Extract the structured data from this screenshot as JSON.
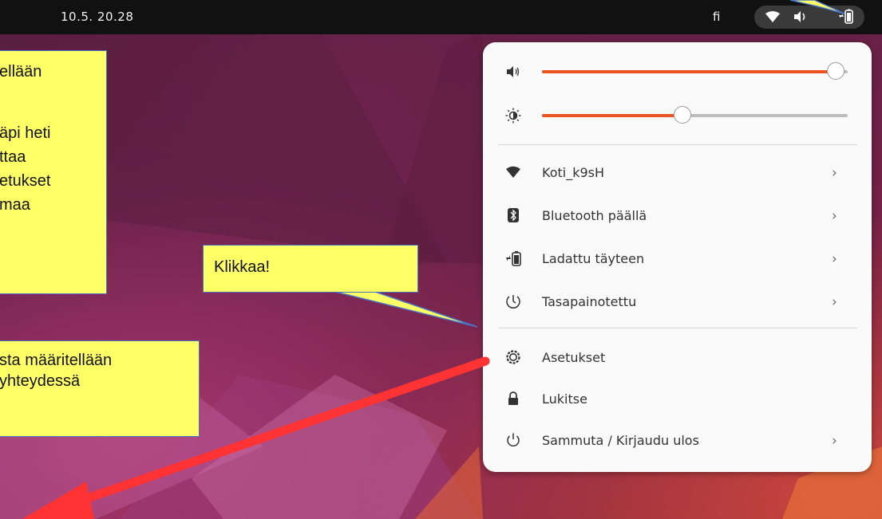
{
  "topbar": {
    "clock": "10.5.  20.28",
    "language": "fi"
  },
  "callouts": {
    "top_left_lines": [
      "ellään",
      "",
      "äpi heti",
      "ttaa",
      "etukset",
      "maa"
    ],
    "middle_left_lines": [
      "sta määritellään",
      "yhteydessä"
    ],
    "klikkaa": "Klikkaa!"
  },
  "quick_settings": {
    "volume_level": 0.96,
    "brightness_level": 0.46,
    "items": [
      {
        "label": "Koti_k9sH",
        "icon": "wifi-icon",
        "has_submenu": true
      },
      {
        "label": "Bluetooth päällä",
        "icon": "bluetooth-icon",
        "has_submenu": true
      },
      {
        "label": "Ladattu täyteen",
        "icon": "battery-icon",
        "has_submenu": true
      },
      {
        "label": "Tasapainotettu",
        "icon": "power-mode-icon",
        "has_submenu": true
      },
      {
        "label": "Asetukset",
        "icon": "settings-gear-icon",
        "has_submenu": false
      },
      {
        "label": "Lukitse",
        "icon": "lock-icon",
        "has_submenu": false
      },
      {
        "label": "Sammuta / Kirjaudu ulos",
        "icon": "power-icon",
        "has_submenu": true
      }
    ],
    "chevron": "›"
  },
  "colors": {
    "accent": "#e95420",
    "callout_fill": "#ffff66",
    "callout_border": "#4a74c4",
    "arrow": "#ff3333",
    "topbar": "#111111"
  }
}
